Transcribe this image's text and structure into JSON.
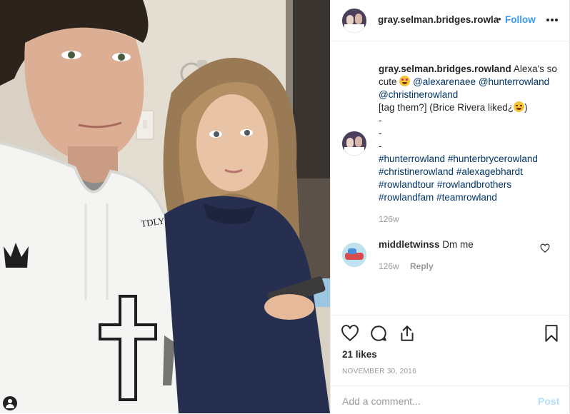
{
  "header": {
    "username": "gray.selman.bridges.rowla",
    "separator": "•",
    "follow_label": "Follow",
    "more_icon": "more-horizontal-icon"
  },
  "caption": {
    "username": "gray.selman.bridges.rowland",
    "text_1": "Alexa's so cute",
    "emoji_1": "heart-eyes-emoji",
    "mention_1": "@alexarenaee",
    "mention_2": "@hunterrowland",
    "mention_3": "@christinerowland",
    "text_2": "[tag them?] (Brice Rivera liked¿",
    "emoji_2": "laughing-emoji",
    "text_3": ")",
    "dashes": [
      "-",
      "-",
      "-"
    ],
    "hashtags": [
      "#hunterrowland",
      "#hunterbrycerowland",
      "#christinerowland",
      "#alexagebhardt",
      "#rowlandtour",
      "#rowlandbrothers",
      "#rowlandfam",
      "#teamrowland"
    ],
    "time": "126w"
  },
  "comment": {
    "username": "middletwinss",
    "text": "Dm me",
    "time": "126w",
    "reply_label": "Reply"
  },
  "actions": {
    "likes": "21 likes",
    "date": "NOVEMBER 30, 2016",
    "icons": [
      "heart-icon",
      "comment-icon",
      "share-icon",
      "bookmark-icon"
    ]
  },
  "comment_box": {
    "placeholder": "Add a comment...",
    "post_label": "Post"
  },
  "colors": {
    "link_blue": "#3897f0",
    "hashtag_blue": "#003569",
    "muted_gray": "#999999",
    "post_disabled": "#b2dffc"
  }
}
